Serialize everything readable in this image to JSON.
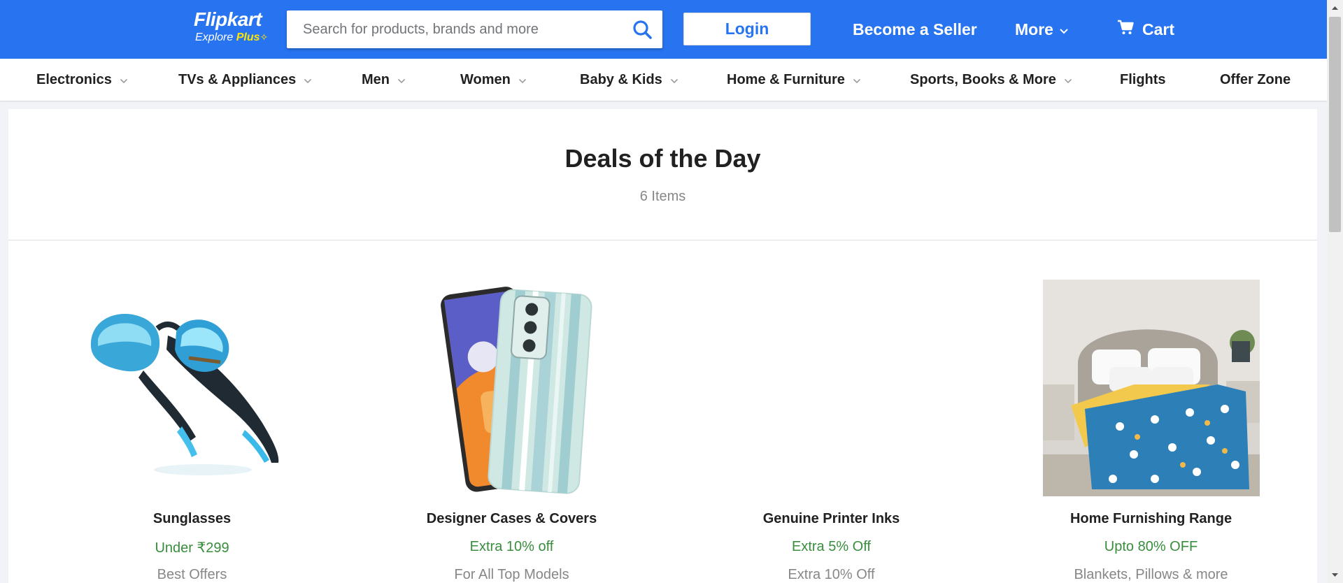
{
  "header": {
    "logo_text": "Flipkart",
    "logo_sub_text": "Explore",
    "logo_plus_text": "Plus",
    "search_placeholder": "Search for products, brands and more",
    "search_value": "",
    "login_label": "Login",
    "become_seller_label": "Become a Seller",
    "more_label": "More",
    "cart_label": "Cart",
    "icons": [
      "search-icon",
      "chevron-down-icon",
      "cart-icon",
      "plus-star-icon"
    ]
  },
  "categories": [
    {
      "label": "Electronics",
      "has_dropdown": true
    },
    {
      "label": "TVs & Appliances",
      "has_dropdown": true
    },
    {
      "label": "Men",
      "has_dropdown": true
    },
    {
      "label": "Women",
      "has_dropdown": true
    },
    {
      "label": "Baby & Kids",
      "has_dropdown": true
    },
    {
      "label": "Home & Furniture",
      "has_dropdown": true
    },
    {
      "label": "Sports, Books & More",
      "has_dropdown": true
    },
    {
      "label": "Flights",
      "has_dropdown": false
    },
    {
      "label": "Offer Zone",
      "has_dropdown": false
    }
  ],
  "deals": {
    "title": "Deals of the Day",
    "count_text": "6 Items",
    "items": [
      {
        "name": "Sunglasses",
        "offer": "Under ₹299",
        "desc": "Best Offers",
        "image": "sunglasses-image"
      },
      {
        "name": "Designer Cases & Covers",
        "offer": "Extra 10% off",
        "desc": "For All Top Models",
        "image": "phone-case-image"
      },
      {
        "name": "Genuine Printer Inks",
        "offer": "Extra 5% Off",
        "desc": "Extra 10% Off",
        "image": "printer-ink-image-not-loaded"
      },
      {
        "name": "Home Furnishing Range",
        "offer": "Upto 80% OFF",
        "desc": "Blankets, Pillows & more",
        "image": "bedding-image"
      }
    ]
  },
  "colors": {
    "brand_blue": "#2874f0",
    "offer_green": "#388e3c",
    "muted_gray": "#878787",
    "logo_yellow": "#ffe500"
  }
}
